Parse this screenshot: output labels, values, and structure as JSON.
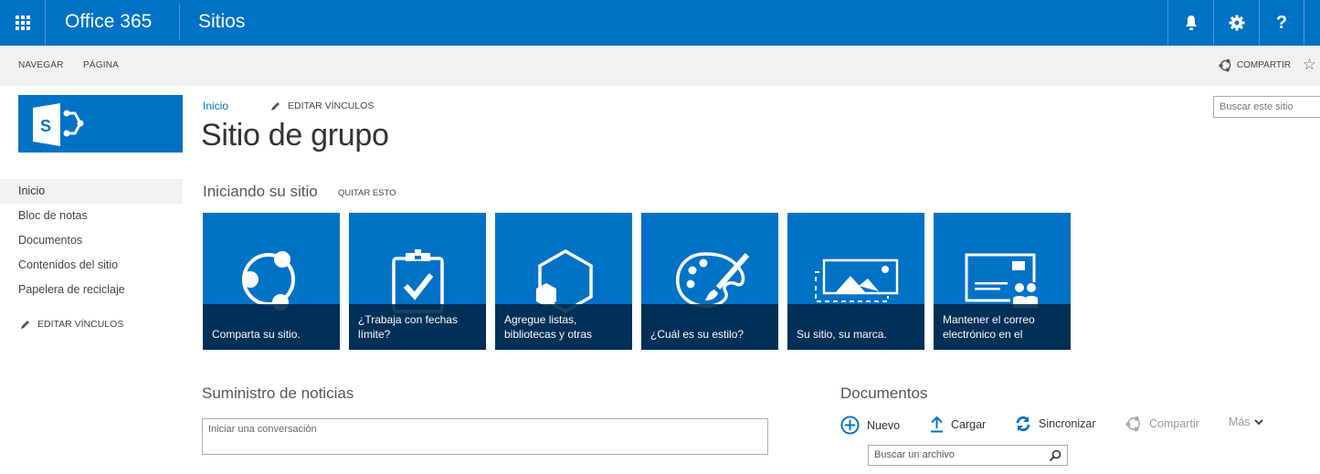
{
  "suitebar": {
    "brand": "Office 365",
    "app_name": "Sitios",
    "icons": [
      "app-launcher-icon",
      "bell-icon",
      "gear-icon",
      "help-icon"
    ],
    "help_glyph": "?"
  },
  "ribbon": {
    "tabs": [
      "NAVEGAR",
      "PÁGINA"
    ],
    "share_label": "COMPARTIR",
    "follow_glyph": "☆"
  },
  "search": {
    "site_placeholder": "Buscar este sitio"
  },
  "leftnav": {
    "items": [
      {
        "label": "Inicio",
        "active": true
      },
      {
        "label": "Bloc de notas",
        "active": false
      },
      {
        "label": "Documentos",
        "active": false
      },
      {
        "label": "Contenidos del sitio",
        "active": false
      },
      {
        "label": "Papelera de reciclaje",
        "active": false
      }
    ],
    "edit_links": "EDITAR VÍNCULOS"
  },
  "header": {
    "breadcrumb": "Inicio",
    "edit_links": "EDITAR VÍNCULOS",
    "title": "Sitio de grupo"
  },
  "getting_started": {
    "title": "Iniciando su sitio",
    "remove_label": "QUITAR ESTO",
    "tiles": [
      {
        "label": "Comparta su sitio.",
        "icon": "share-icon"
      },
      {
        "label": "¿Trabaja con fechas límite?",
        "icon": "clipboard-check-icon"
      },
      {
        "label": "Agregue listas, bibliotecas y otras",
        "icon": "apps-hexagon-icon"
      },
      {
        "label": "¿Cuál es su estilo?",
        "icon": "palette-icon"
      },
      {
        "label": "Su sitio, su marca.",
        "icon": "image-brand-icon"
      },
      {
        "label": "Mantener el correo electrónico en el",
        "icon": "mailbox-people-icon"
      }
    ]
  },
  "newsfeed": {
    "title": "Suministro de noticias",
    "placeholder": "Iniciar una conversación"
  },
  "documents": {
    "title": "Documentos",
    "commands": [
      {
        "label": "Nuevo",
        "icon": "plus-circle-icon",
        "enabled": true
      },
      {
        "label": "Cargar",
        "icon": "upload-icon",
        "enabled": true
      },
      {
        "label": "Sincronizar",
        "icon": "sync-icon",
        "enabled": true
      },
      {
        "label": "Compartir",
        "icon": "share-icon",
        "enabled": false
      },
      {
        "label": "Más",
        "icon": "chevron-down-icon",
        "enabled": false
      }
    ],
    "search_placeholder": "Buscar un archivo"
  },
  "colors": {
    "brand_blue": "#0072c6",
    "tile_caption": "#002648",
    "ribbon_bg": "#f1f1f1"
  }
}
